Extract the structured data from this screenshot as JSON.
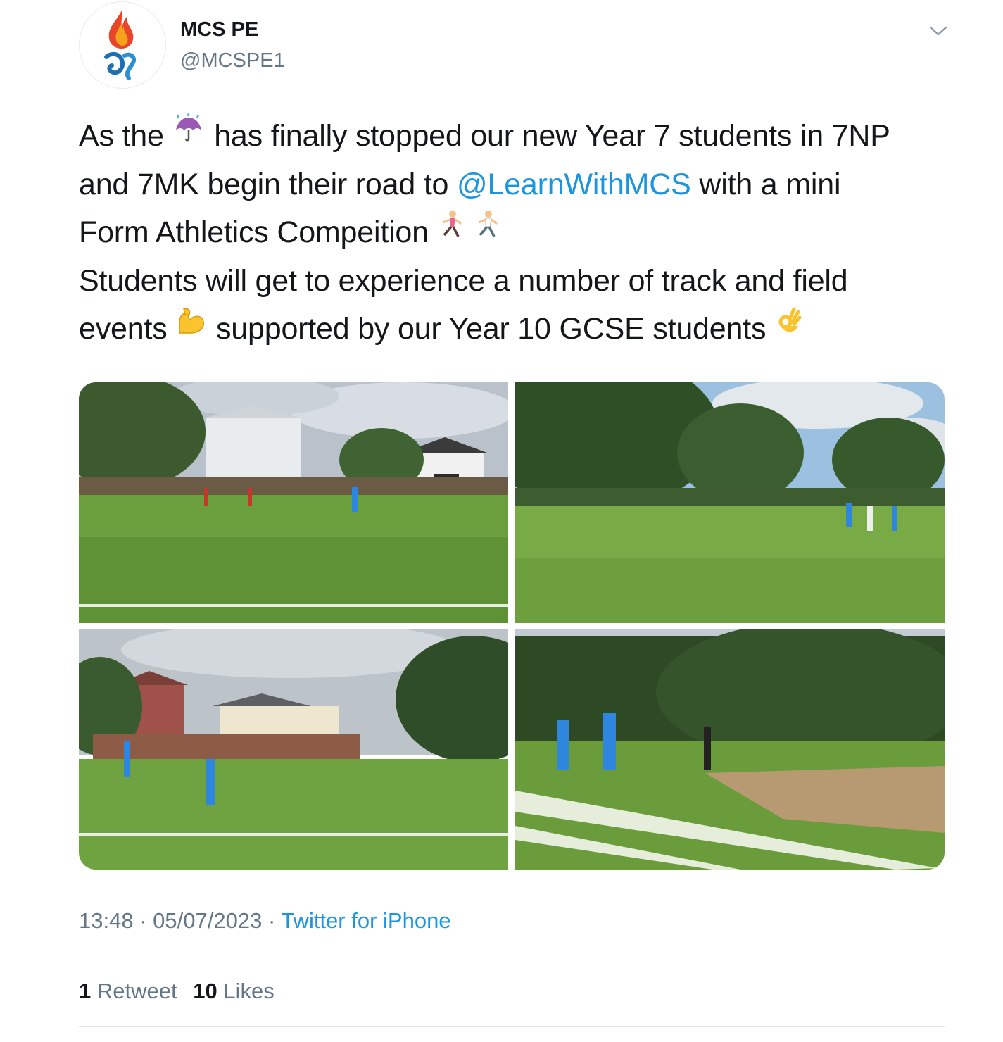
{
  "author": {
    "display_name": "MCS PE",
    "handle": "@MCSPE1",
    "avatar_icon": "mcs-flame-logo"
  },
  "tweet": {
    "line1_a": "As the",
    "emoji_umbrella": "umbrella-with-rain-icon",
    "line1_b": "has finally stopped our new Year 7 students in 7NP",
    "line2_a": "and 7MK begin their road to",
    "mention": "@LearnWithMCS",
    "line2_b": "with a mini",
    "line3": "Form Athletics Compeition",
    "emoji_runners": [
      "woman-running-icon",
      "man-running-icon"
    ],
    "line4": "Students will get to experience a number of track and field",
    "line5_a": "events",
    "emoji_muscle": "flexed-biceps-icon",
    "line5_b": "supported by our Year 10 GCSE students",
    "emoji_ok": "ok-hand-icon"
  },
  "media": {
    "photos": [
      "athletics-photo-1",
      "athletics-photo-2",
      "athletics-photo-3",
      "athletics-photo-4"
    ]
  },
  "meta": {
    "time": "13:48",
    "separator": "·",
    "date": "05/07/2023",
    "source": "Twitter for iPhone"
  },
  "stats": {
    "retweets_count": "1",
    "retweets_label": "Retweet",
    "likes_count": "10",
    "likes_label": "Likes"
  },
  "colors": {
    "link": "#1b95e0",
    "secondary": "#657786",
    "text": "#14171a",
    "divider": "#e1e8ed"
  }
}
